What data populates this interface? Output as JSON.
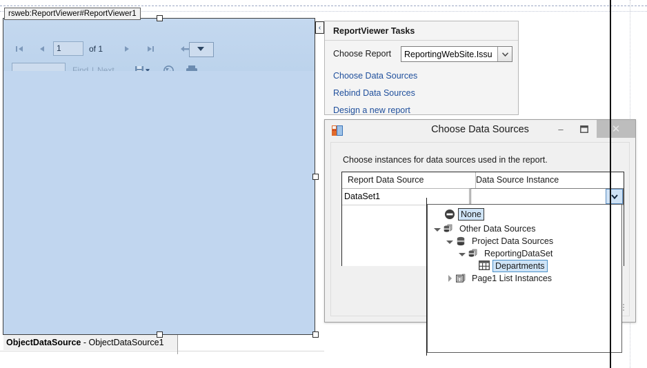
{
  "designer": {
    "control_tag": "rsweb:ReportViewer#ReportViewer1",
    "object_data_source_bold": "ObjectDataSource",
    "object_data_source_rest": " - ObjectDataSource1"
  },
  "report_viewer": {
    "toolbar": {
      "first_page_icon": "first-page-icon",
      "prev_page_icon": "previous-page-icon",
      "page_number_value": "1",
      "of_total_label": "of 1",
      "next_page_icon": "next-page-icon",
      "last_page_icon": "last-page-icon",
      "back_icon": "back-parent-report-icon",
      "zoom_value": "",
      "find_value": "",
      "find_label": "Find",
      "separator_label": "|",
      "next_label": "Next",
      "export_icon": "save-export-icon",
      "refresh_icon": "refresh-icon",
      "print_icon": "print-icon"
    }
  },
  "smart_tag": {
    "chevron_label": "‹"
  },
  "tasks_panel": {
    "title": "ReportViewer Tasks",
    "choose_report_label": "Choose Report",
    "choose_report_value": "ReportingWebSite.Issu",
    "links": [
      {
        "label": "Choose Data Sources"
      },
      {
        "label": "Rebind Data Sources"
      },
      {
        "label": "Design a new report"
      }
    ]
  },
  "dialog": {
    "title": "Choose Data Sources",
    "icon_name": "visual-studio-form-icon",
    "minimize_label": "–",
    "maximize_label": "❐",
    "close_label": "✕",
    "instruction": "Choose instances for data sources used in the report.",
    "grid": {
      "headers": [
        "Report Data Source",
        "Data Source Instance"
      ],
      "rows": [
        {
          "report_data_source": "DataSet1",
          "data_source_instance": ""
        }
      ]
    }
  },
  "dropdown": {
    "items": [
      {
        "label": "None",
        "icon": "none-forbidden-icon",
        "indent": 0,
        "expander": "none",
        "selected": true
      },
      {
        "label": "Other Data Sources",
        "icon": "data-sources-icon",
        "indent": 0,
        "expander": "open",
        "selected": false
      },
      {
        "label": "Project Data Sources",
        "icon": "database-icon",
        "indent": 1,
        "expander": "open",
        "selected": false
      },
      {
        "label": "ReportingDataSet",
        "icon": "dataset-icon",
        "indent": 2,
        "expander": "open",
        "selected": false
      },
      {
        "label": "Departments",
        "icon": "table-grid-icon",
        "indent": 3,
        "expander": "none",
        "selected": true
      },
      {
        "label": "Page1 List Instances",
        "icon": "page-list-icon",
        "indent": 1,
        "expander": "closed",
        "selected": false
      }
    ]
  },
  "colors": {
    "report_body": "#c1d6ef",
    "toolbar": "#c4d8ef",
    "link": "#1f4f9c",
    "selection_blue": "#cfe4f7",
    "dialog_bg": "#f0f0f0"
  }
}
